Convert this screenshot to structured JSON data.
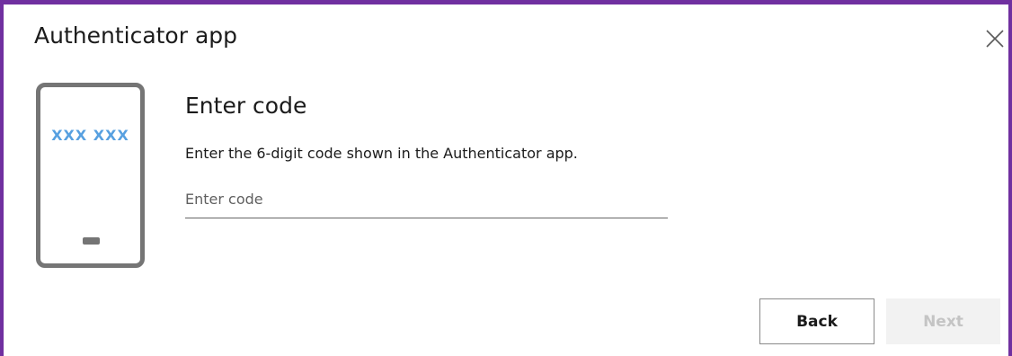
{
  "dialog": {
    "title": "Authenticator app",
    "close_icon": "close-icon"
  },
  "illustration": {
    "icon": "phone-icon",
    "code_text": "XXX XXX"
  },
  "content": {
    "heading": "Enter code",
    "description": "Enter the 6-digit code shown in the Authenticator app.",
    "code_input": {
      "value": "",
      "placeholder": "Enter code"
    }
  },
  "actions": {
    "back_label": "Back",
    "next_label": "Next",
    "next_disabled": true
  },
  "colors": {
    "accent_border": "#7030a0",
    "code_text": "#57a0e0",
    "phone_outline": "#757575",
    "disabled_button_bg": "#f2f2f2",
    "disabled_button_text": "#c4c4c4"
  }
}
